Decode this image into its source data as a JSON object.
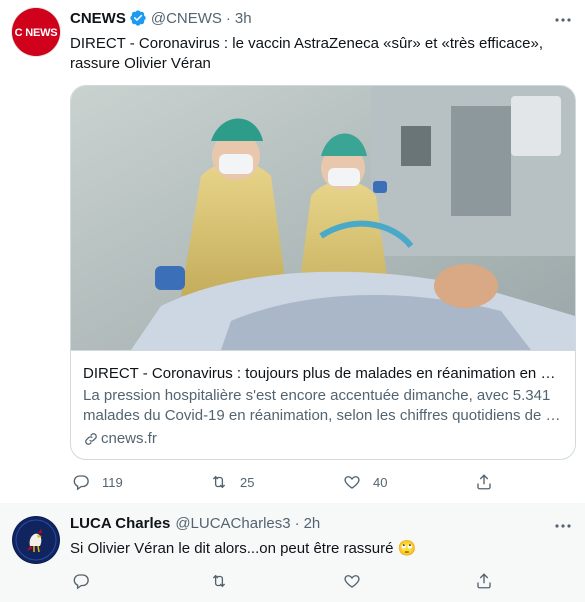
{
  "tweets": [
    {
      "author_name": "CNEWS",
      "handle": "@CNEWS",
      "separator": "·",
      "time": "3h",
      "avatar_text": "C NEWS",
      "text_line1": "DIRECT - Coronavirus : le vaccin AstraZeneca «sûr» et «très efficace»,",
      "text_line2": "rassure Olivier Véran",
      "card": {
        "title": "DIRECT - Coronavirus : toujours plus de malades en réanimation en …",
        "desc_line1": "La pression hospitalière s'est encore accentuée dimanche, avec 5.341",
        "desc_line2": "malades du Covid-19 en réanimation, selon les chiffres quotidiens de …",
        "domain": "cnews.fr"
      },
      "stats": {
        "replies": "119",
        "retweets": "25",
        "likes": "40"
      }
    },
    {
      "author_name": "LUCA Charles",
      "handle": "@LUCACharles3",
      "separator": "·",
      "time": "2h",
      "text": "Si Olivier Véran le dit alors...on peut être rassuré 🙄"
    }
  ],
  "colors": {
    "accent": "#1d9bf0",
    "secondary_text": "#536471",
    "border": "#cfd9de",
    "cnews_red": "#d0021b"
  }
}
